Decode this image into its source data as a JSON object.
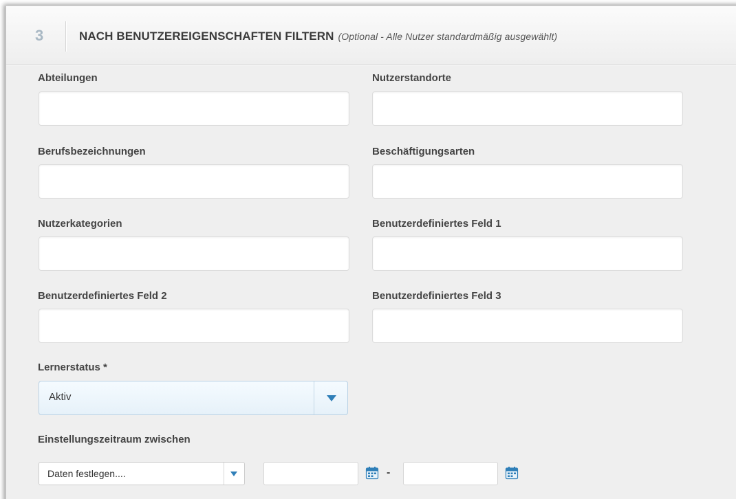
{
  "header": {
    "step_number": "3",
    "title": "NACH BENUTZEREIGENSCHAFTEN FILTERN",
    "subtitle": "(Optional - Alle Nutzer standardmäßig ausgewählt)"
  },
  "fields": {
    "abteilungen": {
      "label": "Abteilungen",
      "value": ""
    },
    "nutzerstandorte": {
      "label": "Nutzerstandorte",
      "value": ""
    },
    "berufsbezeichnungen": {
      "label": "Berufsbezeichnungen",
      "value": ""
    },
    "beschaeftigungsarten": {
      "label": "Beschäftigungsarten",
      "value": ""
    },
    "nutzerkategorien": {
      "label": "Nutzerkategorien",
      "value": ""
    },
    "custom_field_1": {
      "label": "Benutzerdefiniertes Feld 1",
      "value": ""
    },
    "custom_field_2": {
      "label": "Benutzerdefiniertes Feld 2",
      "value": ""
    },
    "custom_field_3": {
      "label": "Benutzerdefiniertes Feld 3",
      "value": ""
    }
  },
  "learner_status": {
    "label": "Lernerstatus *",
    "selected": "Aktiv",
    "arrow_icon": "chevron-down-icon"
  },
  "hire_period": {
    "label": "Einstellungszeitraum zwischen",
    "preset_selected": "Daten festlegen....",
    "start_date": "",
    "end_date": "",
    "separator": "-",
    "calendar_icon": "calendar-icon"
  },
  "colors": {
    "accent": "#2f7fb8",
    "panel_background": "#efefef",
    "step_number": "#a9b8c4",
    "select_background": "#e6f1f9"
  }
}
